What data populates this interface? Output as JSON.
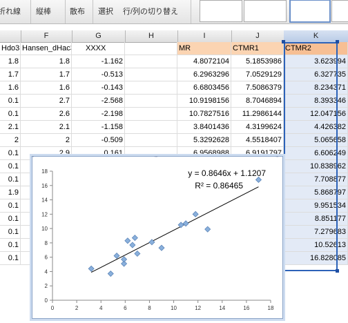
{
  "ribbon": {
    "items": [
      "折れ線",
      "縦棒",
      "散布",
      "選択",
      "行/列の切り替え"
    ]
  },
  "columns": [
    "",
    "F",
    "G",
    "H",
    "I",
    "J",
    "K"
  ],
  "headers": {
    "e": "Hdo33",
    "f": "Hansen_dHac33",
    "g": "XXXX",
    "h": "",
    "i": "MR",
    "j": "CTMR1",
    "k": "CTMR2"
  },
  "rows": [
    {
      "e": "1.8",
      "f": "1.8",
      "g": "-1.162",
      "i": "4.8072104",
      "j": "5.1853986",
      "k": "3.623994"
    },
    {
      "e": "1.7",
      "f": "1.7",
      "g": "-0.513",
      "i": "6.2963296",
      "j": "7.0529129",
      "k": "6.327735"
    },
    {
      "e": "1.6",
      "f": "1.6",
      "g": "-0.143",
      "i": "6.6803456",
      "j": "7.5086379",
      "k": "8.234371"
    },
    {
      "e": "0.1",
      "f": "2.7",
      "g": "-2.568",
      "i": "10.9198156",
      "j": "8.7046894",
      "k": "8.393346"
    },
    {
      "e": "0.1",
      "f": "2.6",
      "g": "-2.198",
      "i": "10.7827516",
      "j": "11.2986144",
      "k": "12.047156"
    },
    {
      "e": "2.1",
      "f": "2.1",
      "g": "-1.158",
      "i": "3.8401436",
      "j": "4.3199624",
      "k": "4.426382"
    },
    {
      "e": "2",
      "f": "2",
      "g": "-0.509",
      "i": "5.3292628",
      "j": "4.5518407",
      "k": "5.065658"
    },
    {
      "e": "0.1",
      "f": "2.9",
      "g": "0.161",
      "i": "6.9568988",
      "j": "6.9191797",
      "k": "6.606249"
    },
    {
      "e": "0.1",
      "f": "2.3",
      "g": "-0.534",
      "i": "11.1380028",
      "j": "10.7981234",
      "k": "10.838962"
    },
    {
      "e": "0.1",
      "f": "",
      "g": "",
      "i": "",
      "j": "",
      "k": "7.708877"
    },
    {
      "e": "1.9",
      "f": "",
      "g": "",
      "i": "",
      "j": "",
      "k": "5.868797"
    },
    {
      "e": "0.1",
      "f": "",
      "g": "",
      "i": "",
      "j": "",
      "k": "9.951534"
    },
    {
      "e": "0.1",
      "f": "",
      "g": "",
      "i": "",
      "j": "",
      "k": "8.851177"
    },
    {
      "e": "0.1",
      "f": "",
      "g": "",
      "i": "",
      "j": "",
      "k": "7.279683"
    },
    {
      "e": "0.1",
      "f": "",
      "g": "",
      "i": "",
      "j": "",
      "k": "10.52613"
    },
    {
      "e": "0.1",
      "f": "",
      "g": "",
      "i": "",
      "j": "",
      "k": "16.828085"
    }
  ],
  "chart_data": {
    "type": "scatter",
    "xlim": [
      0,
      18
    ],
    "ylim": [
      0,
      18
    ],
    "xticks": [
      0,
      2,
      4,
      6,
      8,
      10,
      12,
      14,
      16,
      18
    ],
    "yticks": [
      0,
      2,
      4,
      6,
      8,
      10,
      12,
      14,
      16,
      18
    ],
    "grid": false,
    "equation": "y = 0.8646x + 1.1207",
    "r_squared": "R² = 0.86465",
    "trendline": {
      "slope": 0.8646,
      "intercept": 1.1207,
      "x_from": 3.2,
      "x_to": 17.0
    },
    "marker_color": "#8ab0dc",
    "points": [
      [
        3.2,
        4.4
      ],
      [
        4.8,
        3.7
      ],
      [
        5.3,
        6.2
      ],
      [
        5.9,
        5.1
      ],
      [
        5.9,
        5.7
      ],
      [
        6.2,
        8.3
      ],
      [
        6.6,
        7.7
      ],
      [
        6.8,
        8.7
      ],
      [
        7.0,
        6.5
      ],
      [
        8.2,
        8.1
      ],
      [
        9.0,
        7.3
      ],
      [
        10.6,
        10.5
      ],
      [
        11.0,
        10.7
      ],
      [
        11.8,
        12.0
      ],
      [
        12.8,
        9.9
      ],
      [
        17.0,
        16.8
      ]
    ]
  }
}
